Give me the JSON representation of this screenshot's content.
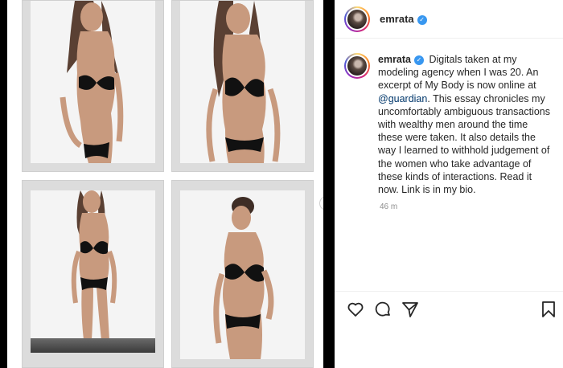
{
  "post": {
    "username": "emrata",
    "caption": {
      "text_before_mention": "Digitals taken at my modeling agency when I was 20. An excerpt of My Body is now online at ",
      "mention": "@guardian",
      "text_after_mention": ". This essay chronicles my uncomfortably ambiguous transactions with wealthy men around the time these were taken. It also details the way I learned to withhold judgement of the women who take advantage of these kinds of interactions. Read it now. Link is in my bio."
    },
    "timestamp": "46 m"
  },
  "icons": {
    "verified": "verified-badge-icon",
    "like": "heart-icon",
    "comment": "comment-icon",
    "share": "paper-plane-icon",
    "save": "bookmark-icon",
    "next": "chevron-right-icon"
  },
  "colors": {
    "verified": "#3897f0",
    "mention": "#00376b",
    "muted": "#8e8e8e",
    "bikini": "#111111",
    "skin": "#c89a7e"
  }
}
